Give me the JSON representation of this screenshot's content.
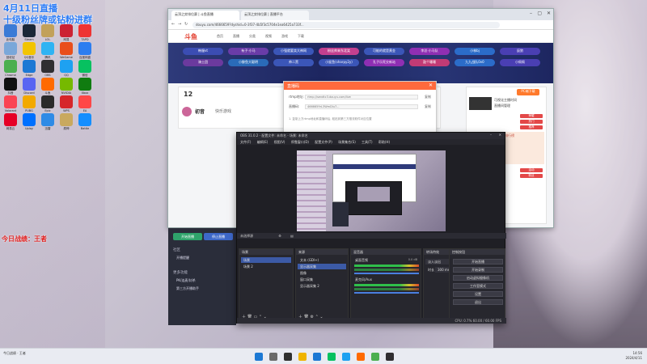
{
  "overlay": {
    "line1": "4月11日直播",
    "line2": "十级粉丝牌或钻粉进群",
    "subtitle": "今日战绩：王者"
  },
  "desktop_icons": [
    {
      "label": "此电脑",
      "color": "#3b7bd6"
    },
    {
      "label": "Steam",
      "color": "#1b2838"
    },
    {
      "label": "LOL",
      "color": "#c2a15a"
    },
    {
      "label": "网易",
      "color": "#cc2233"
    },
    {
      "label": "TAPD",
      "color": "#e33"
    },
    {
      "label": "回收站",
      "color": "#7aa7d9"
    },
    {
      "label": "QQ音乐",
      "color": "#f2c400"
    },
    {
      "label": "腾讯",
      "color": "#2fb3f3"
    },
    {
      "label": "WeGame",
      "color": "#e94e1b"
    },
    {
      "label": "百度网盘",
      "color": "#2c7df0"
    },
    {
      "label": "Chrome",
      "color": "#4caf50"
    },
    {
      "label": "Edge",
      "color": "#1c78d4"
    },
    {
      "label": "OBS",
      "color": "#302e31"
    },
    {
      "label": "QQ",
      "color": "#1ea1f1"
    },
    {
      "label": "微信",
      "color": "#07c160"
    },
    {
      "label": "抖音",
      "color": "#111"
    },
    {
      "label": "Discord",
      "color": "#5865f2"
    },
    {
      "label": "斗鱼",
      "color": "#ff6a00"
    },
    {
      "label": "NVIDIA",
      "color": "#76b900"
    },
    {
      "label": "Xbox",
      "color": "#107c10"
    },
    {
      "label": "Valorant",
      "color": "#fa4454"
    },
    {
      "label": "PUBG",
      "color": "#f2a900"
    },
    {
      "label": "Epic",
      "color": "#2a2a2a"
    },
    {
      "label": "WPS",
      "color": "#d6262a"
    },
    {
      "label": "EA",
      "color": "#ff4747"
    },
    {
      "label": "网易云",
      "color": "#e60026"
    },
    {
      "label": "Uplay",
      "color": "#0070ff"
    },
    {
      "label": "迅雷",
      "color": "#2f8be6"
    },
    {
      "label": "原神",
      "color": "#c9a95f"
    },
    {
      "label": "Battle",
      "color": "#148eff"
    }
  ],
  "browser": {
    "tabs": [
      "云顶之弈排位赛 | 斗鱼直播",
      "云顶之弈排位赛 | 直播平台"
    ],
    "address": "douyu.com/4666659?dyshid=0-3f37-4b5f3c5704e1ea6425a733f...",
    "logo": "斗鱼",
    "nav": [
      "首页",
      "直播",
      "分类",
      "视频",
      "游戏",
      "下载"
    ],
    "channels": [
      {
        "label": "韩服vt",
        "color": "#3b4db3"
      },
      {
        "label": "有子·小马",
        "color": "#6a3ca8"
      },
      {
        "label": "小强就要卖大神网",
        "color": "#3b56b8"
      },
      {
        "label": "粉丝帅来东北笑",
        "color": "#c2408f"
      },
      {
        "label": "可能的就是黄金",
        "color": "#3b56b8"
      },
      {
        "label": "李总·小马队",
        "color": "#8f2fb3"
      },
      {
        "label": "小林bj",
        "color": "#2b6cc9"
      },
      {
        "label": "辰狼",
        "color": "#4a3fb3"
      },
      {
        "label": "骑士团",
        "color": "#6b3a9e"
      },
      {
        "label": "小鲸鱼大聪明",
        "color": "#2a6bb8"
      },
      {
        "label": "帅二黑",
        "color": "#3b56b8"
      },
      {
        "label": "小鲨鱼(sharpy2y)",
        "color": "#3b56b8"
      },
      {
        "label": "孔子乐死交新站",
        "color": "#8f2fb3"
      },
      {
        "label": "鼓个噻噻",
        "color": "#c23b75"
      },
      {
        "label": "九九战队0v0",
        "color": "#2b6cc9"
      },
      {
        "label": "小佩佩",
        "color": "#4a3fb3"
      }
    ],
    "room": {
      "rank": "12",
      "title": "初音",
      "tag": "快乐游戏",
      "gift": "PC端下载"
    },
    "right_panel": {
      "line1": "可视化主播时间",
      "line2": "直播间管理",
      "badges": [
        "荣耀",
        "热门",
        "推荐",
        "活动",
        "粉丝"
      ],
      "tags_text": "粉丝牌·弹幕·礼物·贵族·排行榜"
    },
    "dialog": {
      "title": "直播码",
      "row1_label": "rtmp地址:",
      "row1_value": "rtmp://sendtc3.douyu.com/live",
      "row2_label": "直播码:",
      "row2_value": "4666659rL3WmDlu7...",
      "copy": "复制",
      "note": "1. 复制上方rtmp地址和直播码后, 粘贴到第三方推流软件对应位置"
    }
  },
  "stream_panel": {
    "start_btn": "开始直播",
    "stop_btn": "停止直播",
    "section1": "社区",
    "item1": "开播提醒",
    "section2": "更多功能",
    "item2": "PK/连麦/封杀",
    "item3": "第三方开播助手"
  },
  "obs": {
    "title": "OBS 31.0.2 - 配置文件: 未命名 - 场景: 未命名",
    "menu": [
      "文件(F)",
      "编辑(E)",
      "视图(V)",
      "停靠窗口(D)",
      "配置文件(P)",
      "场景集合(S)",
      "工具(T)",
      "帮助(H)"
    ],
    "source_bar": "未选择源",
    "docks": {
      "scenes": {
        "title": "场景",
        "items": [
          "场景",
          "场景 2"
        ]
      },
      "sources": {
        "title": "来源",
        "items": [
          "文本 (GDI+)",
          "显示器采集",
          "图像",
          "窗口采集",
          "显示器采集 2"
        ]
      },
      "mixer": {
        "title": "混音器",
        "items": [
          "桌面音频",
          "麦克风/Aux"
        ],
        "db": "0.0 dB"
      },
      "transitions": {
        "title": "转场特效",
        "fade": "淡入淡出",
        "duration_label": "时长",
        "duration": "300 ms"
      },
      "controls": {
        "title": "控制按钮",
        "buttons": [
          "开始直播",
          "开始录制",
          "启动虚拟摄像机",
          "工作室模式",
          "设置",
          "退出"
        ]
      }
    },
    "status": "CPU: 0.7%   60.00 / 60.00 FPS"
  },
  "taskbar": {
    "left_text": "今日战绩 · 王者",
    "clock_time": "14:56",
    "clock_date": "2024/4/11"
  }
}
